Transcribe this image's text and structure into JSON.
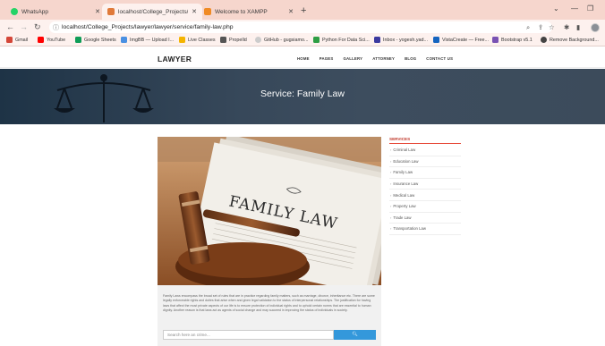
{
  "browser": {
    "tabs": [
      {
        "label": "WhatsApp",
        "favicon_color": "#25d366",
        "active": false
      },
      {
        "label": "localhost/College_Projects/lawye",
        "favicon_color": "#e07a3a",
        "active": true
      },
      {
        "label": "Welcome to XAMPP",
        "favicon_color": "#f08a24",
        "active": false
      }
    ],
    "url": "localhost/College_Projects/lawyer/lawyer/service/family-law.php",
    "bookmarks": [
      {
        "label": "Gmail",
        "color": "#d44638"
      },
      {
        "label": "YouTube",
        "color": "#ff0000"
      },
      {
        "label": "Google Sheets",
        "color": "#0f9d58"
      },
      {
        "label": "ImgBB — Upload I...",
        "color": "#4a90e2"
      },
      {
        "label": "Live Classes",
        "color": "#f4b400"
      },
      {
        "label": "Propelld",
        "color": "#555555"
      },
      {
        "label": "GitHub - gugsiamo...",
        "color": "#cccccc"
      },
      {
        "label": "Python For Data Sci...",
        "color": "#2e9e44"
      },
      {
        "label": "Inbox - yogesh.yad...",
        "color": "#3a3aa0"
      },
      {
        "label": "VistaCreate — Free...",
        "color": "#1565c0"
      },
      {
        "label": "Bootstrap v5.1",
        "color": "#7952b3"
      },
      {
        "label": "Remove Background...",
        "color": "#444444"
      }
    ]
  },
  "site": {
    "brand": "LAWYER",
    "nav": [
      "HOME",
      "PAGES",
      "GALLERY",
      "ATTORNEY",
      "BLOG",
      "CONTACT US"
    ],
    "hero_title": "Service: Family Law",
    "image_caption": "FAMILY LAW",
    "description": "Family Laws encompass the broad set of rules that are in practice regarding family matters, such as marriage, divorce, inheritance etc. There are some legally enforceable rights and duties that arise when and given legal validation to the status of interpersonal relationships. The justification for having laws that affect the most private aspects of our life is to ensure protection of individual rights and to uphold certain norms that are essential to human dignity. Another reason is that laws act as agents of social change and may succeed in improving the status of individuals in society.",
    "search": {
      "placeholder": "Search here an crime..."
    },
    "sidebar": {
      "title": "SERVICES",
      "items": [
        "Criminal Law",
        "Education Law",
        "Family Law",
        "Insurance Law",
        "Medical Law",
        "Property Law",
        "Trade Law",
        "Transportation Law"
      ]
    }
  }
}
